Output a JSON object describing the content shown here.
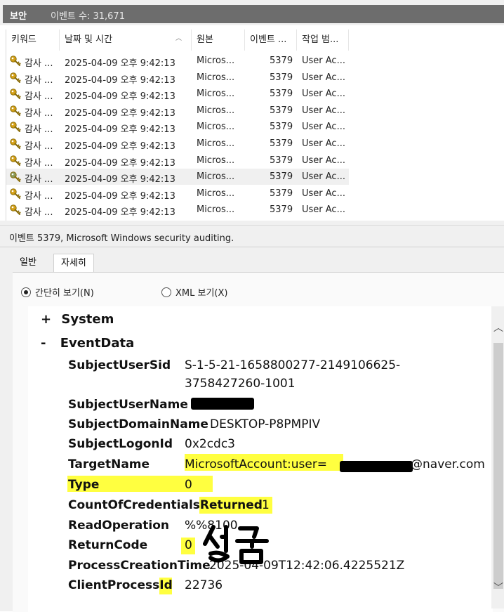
{
  "titlebar": {
    "name": "보안",
    "event_count": "이벤트 수: 31,671"
  },
  "list": {
    "columns": [
      "키워드",
      "날짜 및 시간",
      "원본",
      "이벤트 ...",
      "작업 범..."
    ],
    "rows": [
      {
        "keyword": "감사 ...",
        "datetime": "2025-04-09 오후 9:42:13",
        "source": "Micros...",
        "event_id": "5379",
        "task": "User Ac..."
      },
      {
        "keyword": "감사 ...",
        "datetime": "2025-04-09 오후 9:42:13",
        "source": "Micros...",
        "event_id": "5379",
        "task": "User Ac..."
      },
      {
        "keyword": "감사 ...",
        "datetime": "2025-04-09 오후 9:42:13",
        "source": "Micros...",
        "event_id": "5379",
        "task": "User Ac..."
      },
      {
        "keyword": "감사 ...",
        "datetime": "2025-04-09 오후 9:42:13",
        "source": "Micros...",
        "event_id": "5379",
        "task": "User Ac..."
      },
      {
        "keyword": "감사 ...",
        "datetime": "2025-04-09 오후 9:42:13",
        "source": "Micros...",
        "event_id": "5379",
        "task": "User Ac..."
      },
      {
        "keyword": "감사 ...",
        "datetime": "2025-04-09 오후 9:42:13",
        "source": "Micros...",
        "event_id": "5379",
        "task": "User Ac..."
      },
      {
        "keyword": "감사 ...",
        "datetime": "2025-04-09 오후 9:42:13",
        "source": "Micros...",
        "event_id": "5379",
        "task": "User Ac..."
      },
      {
        "keyword": "감사 ...",
        "datetime": "2025-04-09 오후 9:42:13",
        "source": "Micros...",
        "event_id": "5379",
        "task": "User Ac..."
      },
      {
        "keyword": "감사 ...",
        "datetime": "2025-04-09 오후 9:42:13",
        "source": "Micros...",
        "event_id": "5379",
        "task": "User Ac..."
      },
      {
        "keyword": "감사 ...",
        "datetime": "2025-04-09 오후 9:42:13",
        "source": "Micros...",
        "event_id": "5379",
        "task": "User Ac..."
      }
    ]
  },
  "detail": {
    "title": "이벤트 5379, Microsoft Windows security auditing.",
    "tabs": [
      "일반",
      "자세히"
    ],
    "view_friendly": "간단히 보기(N)",
    "view_xml": "XML 보기(X)",
    "system_toggle": "+",
    "system_label": "System",
    "eventdata_toggle": "-",
    "eventdata_label": "EventData",
    "fields": {
      "subject_user_sid": {
        "key": "SubjectUserSid",
        "value_line1": "S-1-5-21-1658800277-2149106625-",
        "value_line2": "3758427260-1001"
      },
      "subject_user_name": {
        "key": "SubjectUserName"
      },
      "subject_domain_name": {
        "key": "SubjectDomainName",
        "value": "DESKTOP-P8PMPIV"
      },
      "subject_logon_id": {
        "key": "SubjectLogonId",
        "value": "0x2cdc3"
      },
      "target_name": {
        "key": "TargetName",
        "value_prefix": "MicrosoftAccount:user=",
        "value_suffix": "@naver.com"
      },
      "type": {
        "key": "Type",
        "value": "0"
      },
      "count_creds": {
        "key": "CountOfCredentialsReturned",
        "value": "1"
      },
      "read_operation": {
        "key": "ReadOperation",
        "value": "%%8100"
      },
      "return_code": {
        "key": "ReturnCode",
        "value": "0"
      },
      "process_creation_time": {
        "key": "ProcessCreationTime",
        "value": "2025-04-09T12:42:06.4225521Z"
      },
      "client_process_id": {
        "key": "ClientProcessId",
        "value": "22736"
      }
    },
    "annotation": "성공"
  },
  "colors": {
    "highlight": "#ffff40",
    "titlebar": "#6d6d6d",
    "key_icon": "#d4a017"
  }
}
